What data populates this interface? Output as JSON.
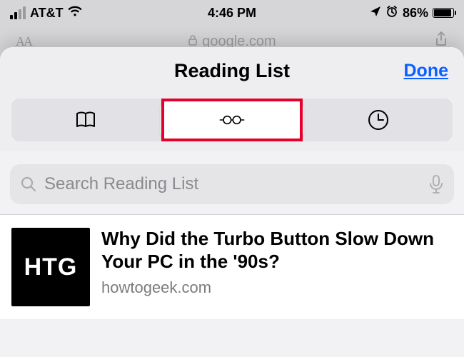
{
  "status": {
    "carrier": "AT&T",
    "time": "4:46 PM",
    "battery_percent": "86%"
  },
  "safari": {
    "address": "google.com"
  },
  "sheet": {
    "title": "Reading List",
    "done": "Done"
  },
  "search": {
    "placeholder": "Search Reading List"
  },
  "items": [
    {
      "thumb_text": "HTG",
      "title": "Why Did the Turbo Button Slow Down Your PC in the '90s?",
      "domain": "howtogeek.com"
    }
  ]
}
